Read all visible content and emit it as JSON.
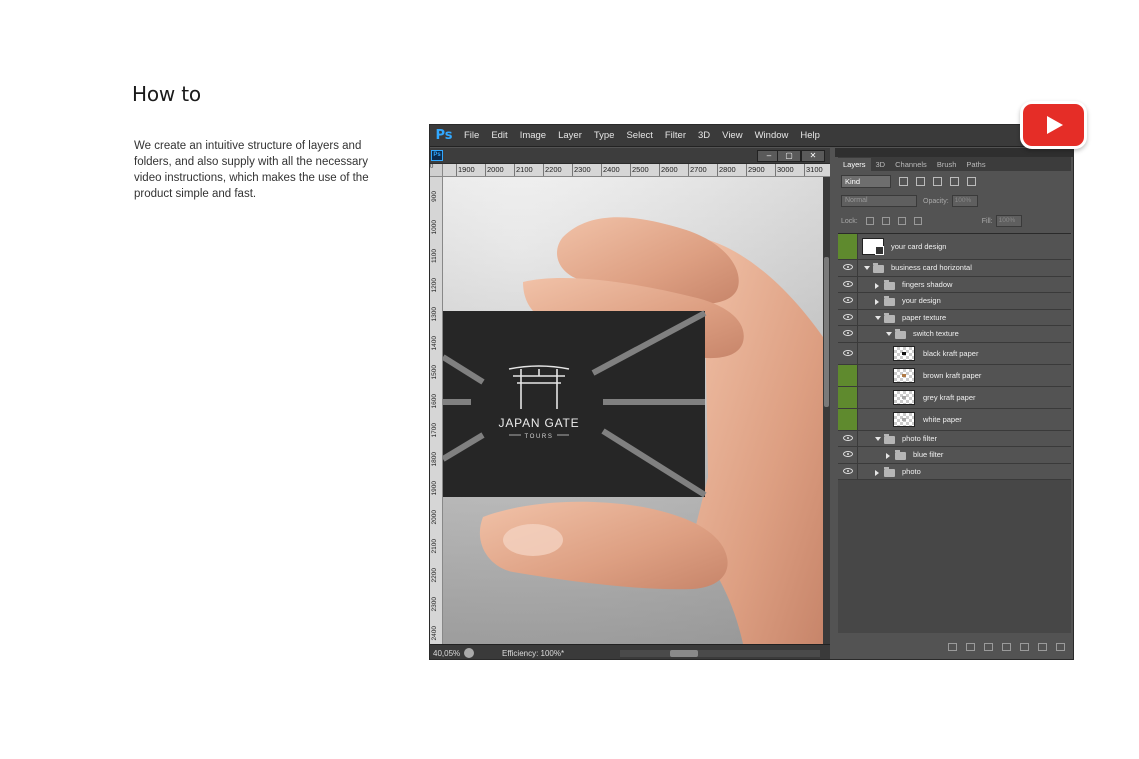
{
  "page": {
    "heading": "How to",
    "description": "We create an intuitive structure of layers and folders, and also supply with all the necessary video instructions, which makes the use of the product simple and fast."
  },
  "app": {
    "logo": "Ps",
    "menu": [
      "File",
      "Edit",
      "Image",
      "Layer",
      "Type",
      "Select",
      "Filter",
      "3D",
      "View",
      "Window",
      "Help"
    ]
  },
  "document": {
    "badge": "Ps",
    "ruler_top": [
      "1900",
      "2000",
      "2100",
      "2200",
      "2300",
      "2400",
      "2500",
      "2600",
      "2700",
      "2800",
      "2900",
      "3000",
      "3100"
    ],
    "ruler_left": [
      "900",
      "1000",
      "1100",
      "1200",
      "1300",
      "1400",
      "1500",
      "1600",
      "1700",
      "1800",
      "1900",
      "2000",
      "2100",
      "2200",
      "2300",
      "2400"
    ],
    "ruler_corner": "0",
    "zoom": "40,05%",
    "efficiency": "Efficiency: 100%*",
    "card": {
      "title": "JAPAN GATE",
      "subtitle": "TOURS"
    }
  },
  "panel": {
    "tabs": [
      "Layers",
      "3D",
      "Channels",
      "Brush",
      "Paths"
    ],
    "kind_label": "Kind",
    "blend_mode": "Normal",
    "opacity_label": "Opacity:",
    "opacity_value": "100%",
    "lock_label": "Lock:",
    "fill_label": "Fill:",
    "fill_value": "100%",
    "layers": [
      {
        "name": "your card design",
        "type": "smart",
        "indent": 0,
        "visible": false
      },
      {
        "name": "business card horizontal",
        "type": "folder-open",
        "indent": 0,
        "visible": true
      },
      {
        "name": "fingers shadow",
        "type": "folder-closed",
        "indent": 1,
        "visible": true
      },
      {
        "name": "your design",
        "type": "folder-closed",
        "indent": 1,
        "visible": true
      },
      {
        "name": "paper texture",
        "type": "folder-open",
        "indent": 1,
        "visible": true
      },
      {
        "name": "switch texture",
        "type": "folder-open",
        "indent": 2,
        "visible": true
      },
      {
        "name": "black kraft paper",
        "type": "layer",
        "indent": 3,
        "visible": true
      },
      {
        "name": "brown kraft paper",
        "type": "layer",
        "indent": 3,
        "visible": false
      },
      {
        "name": "grey kraft paper",
        "type": "layer",
        "indent": 3,
        "visible": false
      },
      {
        "name": "white paper",
        "type": "layer",
        "indent": 3,
        "visible": false
      },
      {
        "name": "photo filter",
        "type": "folder-open",
        "indent": 1,
        "visible": true
      },
      {
        "name": "blue filter",
        "type": "folder-closed",
        "indent": 2,
        "visible": true
      },
      {
        "name": "photo",
        "type": "folder-closed",
        "indent": 1,
        "visible": true
      }
    ]
  },
  "colors": {
    "visibility_green": "#5f8a2e",
    "youtube_red": "#e52d27"
  }
}
